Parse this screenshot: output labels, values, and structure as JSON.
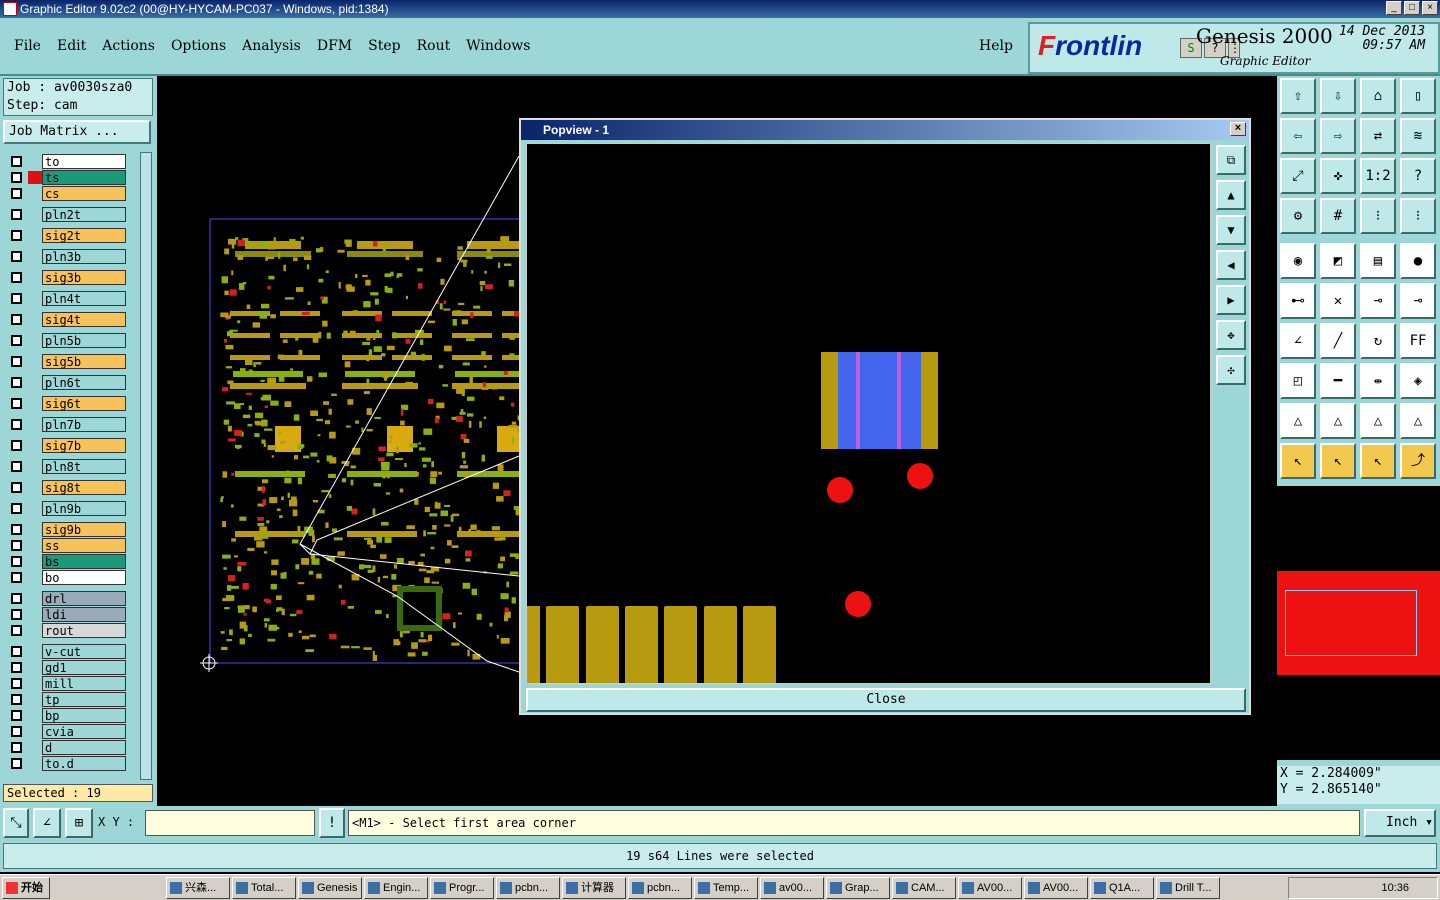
{
  "window": {
    "title": "Graphic Editor 9.02c2 (00@HY-HYCAM-PC037 - Windows, pid:1384)"
  },
  "menu": {
    "items": [
      "File",
      "Edit",
      "Actions",
      "Options",
      "Analysis",
      "DFM",
      "Step",
      "Rout",
      "Windows"
    ],
    "help": "Help"
  },
  "brand": {
    "logo_prefix": "F",
    "logo_rest": "rontlin",
    "product": "Genesis 2000",
    "subtitle": "Graphic Editor",
    "date": "14 Dec 2013",
    "time": "09:57 AM"
  },
  "job": {
    "job_line": "Job : av0030sza0",
    "step_line": "Step: cam",
    "matrix_button": "Job Matrix ..."
  },
  "layers": [
    {
      "name": "to",
      "color": "#ffffff",
      "mark": ""
    },
    {
      "name": "ts",
      "color": "#1a9a7a",
      "mark": "#e01010"
    },
    {
      "name": "cs",
      "color": "#f7c25a",
      "mark": ""
    },
    {
      "name": "pln2t",
      "color": "#9dd6d6",
      "mark": ""
    },
    {
      "name": "sig2t",
      "color": "#f7c25a",
      "mark": ""
    },
    {
      "name": "pln3b",
      "color": "#9dd6d6",
      "mark": ""
    },
    {
      "name": "sig3b",
      "color": "#f7c25a",
      "mark": ""
    },
    {
      "name": "pln4t",
      "color": "#9dd6d6",
      "mark": ""
    },
    {
      "name": "sig4t",
      "color": "#f7c25a",
      "mark": ""
    },
    {
      "name": "pln5b",
      "color": "#9dd6d6",
      "mark": ""
    },
    {
      "name": "sig5b",
      "color": "#f7c25a",
      "mark": ""
    },
    {
      "name": "pln6t",
      "color": "#9dd6d6",
      "mark": ""
    },
    {
      "name": "sig6t",
      "color": "#f7c25a",
      "mark": ""
    },
    {
      "name": "pln7b",
      "color": "#9dd6d6",
      "mark": ""
    },
    {
      "name": "sig7b",
      "color": "#f7c25a",
      "mark": ""
    },
    {
      "name": "pln8t",
      "color": "#9dd6d6",
      "mark": ""
    },
    {
      "name": "sig8t",
      "color": "#f7c25a",
      "mark": ""
    },
    {
      "name": "pln9b",
      "color": "#9dd6d6",
      "mark": ""
    },
    {
      "name": "sig9b",
      "color": "#f7c25a",
      "mark": ""
    },
    {
      "name": "ss",
      "color": "#f7c25a",
      "mark": ""
    },
    {
      "name": "bs",
      "color": "#1a9a7a",
      "mark": ""
    },
    {
      "name": "bo",
      "color": "#ffffff",
      "mark": ""
    },
    {
      "name": "drl",
      "color": "#9aaab8",
      "mark": ""
    },
    {
      "name": "ldi",
      "color": "#9aaab8",
      "mark": ""
    },
    {
      "name": "rout",
      "color": "#d8d8d8",
      "mark": ""
    },
    {
      "name": "v-cut",
      "color": "#9dd6d6",
      "mark": ""
    },
    {
      "name": "gd1",
      "color": "#9dd6d6",
      "mark": ""
    },
    {
      "name": "mill",
      "color": "#9dd6d6",
      "mark": ""
    },
    {
      "name": "tp",
      "color": "#9dd6d6",
      "mark": ""
    },
    {
      "name": "bp",
      "color": "#9dd6d6",
      "mark": ""
    },
    {
      "name": "cvia",
      "color": "#9dd6d6",
      "mark": ""
    },
    {
      "name": "d",
      "color": "#9dd6d6",
      "mark": ""
    },
    {
      "name": "to.d",
      "color": "#9dd6d6",
      "mark": ""
    }
  ],
  "selected": "Selected : 19",
  "popview": {
    "title": "Popview - 1",
    "close": "Close"
  },
  "coords": {
    "x": "X = 2.284009\"",
    "y": "Y = 2.865140\""
  },
  "bottom": {
    "xy_label": "X Y :",
    "xy_value": "",
    "prompt": "<M1> - Select first area corner",
    "unit": "Inch"
  },
  "status": {
    "message": "19 s64 Lines were selected"
  },
  "taskbar": {
    "start": "开始",
    "tasks": [
      "兴森...",
      "Total...",
      "Genesis",
      "Engin...",
      "Progr...",
      "pcbn...",
      "计算器",
      "pcbn...",
      "Temp...",
      "av00...",
      "Grap...",
      "CAM...",
      "AV00...",
      "AV00...",
      "Q1A...",
      "Drill T..."
    ],
    "clock": "10:36"
  },
  "colors": {
    "panel": "#9dd6d6",
    "copper": "#b89a10",
    "pad_blue": "#4466ee",
    "drill_red": "#ee1111"
  }
}
